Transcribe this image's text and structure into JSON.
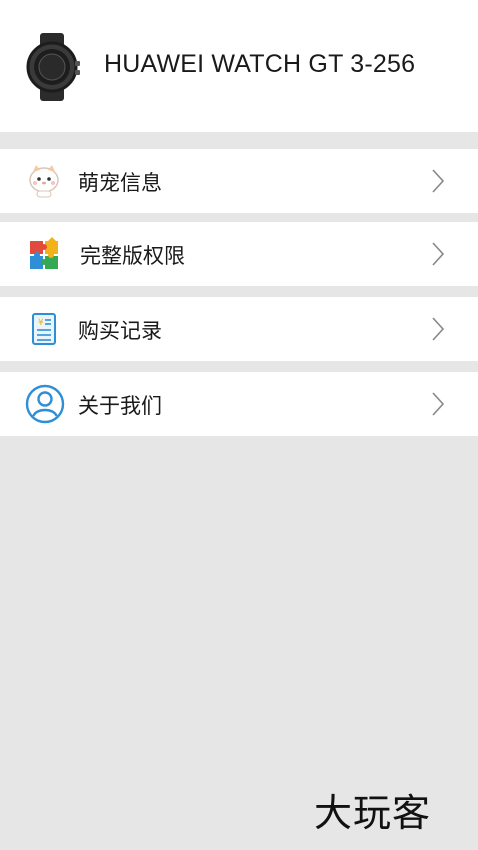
{
  "header": {
    "device_name": "HUAWEI WATCH GT 3-256",
    "watch_icon": "smartwatch-icon"
  },
  "menu": [
    {
      "label": "萌宠信息",
      "icon": "pet-face-icon"
    },
    {
      "label": "完整版权限",
      "icon": "puzzle-icon"
    },
    {
      "label": "购买记录",
      "icon": "receipt-icon"
    },
    {
      "label": "关于我们",
      "icon": "user-circle-icon"
    }
  ],
  "chevron_icon": "chevron-right-icon",
  "brand": "大玩客",
  "colors": {
    "background": "#e6e6e6",
    "row": "#ffffff",
    "accent_blue": "#2f8fd6"
  }
}
